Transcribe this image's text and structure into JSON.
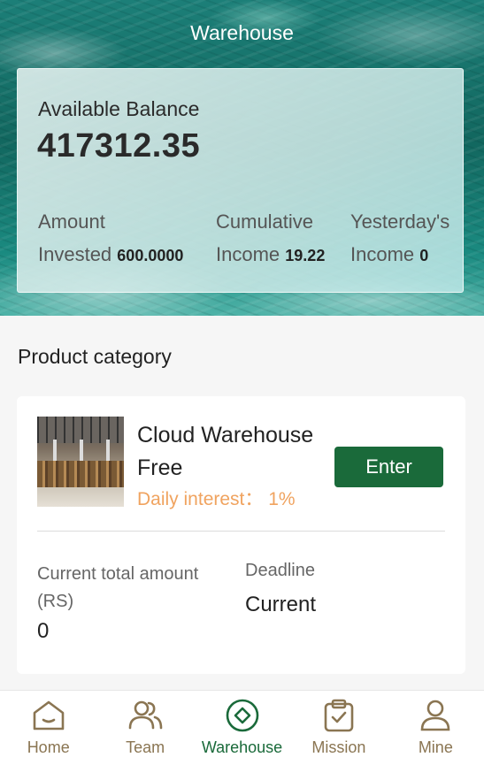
{
  "header": {
    "title": "Warehouse"
  },
  "balance": {
    "label": "Available Balance",
    "value": "417312.35",
    "stats": [
      {
        "label_line1": "Amount",
        "label_line2": "Invested",
        "value": "600.0000"
      },
      {
        "label_line1": "Cumulative",
        "label_line2": "Income",
        "value": "19.22"
      },
      {
        "label_line1": "Yesterday's",
        "label_line2": "Income",
        "value": "0"
      }
    ]
  },
  "products": {
    "section_title": "Product category",
    "items": [
      {
        "name": "Cloud Warehouse Free",
        "daily_interest": "Daily interest：  1%",
        "enter_label": "Enter",
        "amount_label": "Current total amount (RS)",
        "amount_value": "0",
        "deadline_label": "Deadline",
        "deadline_value": "Current"
      }
    ]
  },
  "nav": {
    "items": [
      {
        "label": "Home",
        "icon": "home-icon"
      },
      {
        "label": "Team",
        "icon": "team-icon"
      },
      {
        "label": "Warehouse",
        "icon": "warehouse-icon",
        "active": true
      },
      {
        "label": "Mission",
        "icon": "mission-icon"
      },
      {
        "label": "Mine",
        "icon": "mine-icon"
      }
    ]
  },
  "colors": {
    "accent_green": "#1a6a3a",
    "nav_brown": "#8a7552",
    "interest_orange": "#f0a35f"
  }
}
